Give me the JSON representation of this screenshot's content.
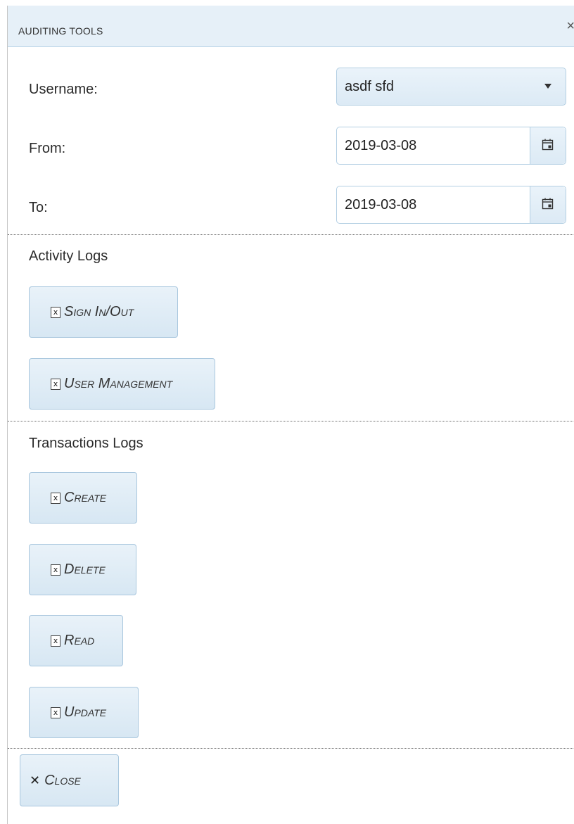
{
  "dialog": {
    "title": "AUDITING TOOLS",
    "close_glyph": "×"
  },
  "filters": {
    "username_label": "Username:",
    "username_value": "asdf sfd",
    "from_label": "From:",
    "from_value": "2019-03-08",
    "to_label": "To:",
    "to_value": "2019-03-08",
    "calendar_icon": "calendar-icon"
  },
  "activity_logs": {
    "title": "Activity Logs",
    "buttons": [
      {
        "label": "Sign In/Out",
        "icon": "excel-icon"
      },
      {
        "label": "User Management",
        "icon": "excel-icon"
      }
    ]
  },
  "transactions_logs": {
    "title": "Transactions Logs",
    "buttons": [
      {
        "label": "Create",
        "icon": "excel-icon"
      },
      {
        "label": "Delete",
        "icon": "excel-icon"
      },
      {
        "label": "Read",
        "icon": "excel-icon"
      },
      {
        "label": "Update",
        "icon": "excel-icon"
      }
    ]
  },
  "footer": {
    "close_label": "Close",
    "close_glyph": "✕"
  },
  "colors": {
    "titlebar_bg": "#e6f0f8",
    "button_bg": "#dceaf5",
    "border": "#b3cfe3"
  }
}
